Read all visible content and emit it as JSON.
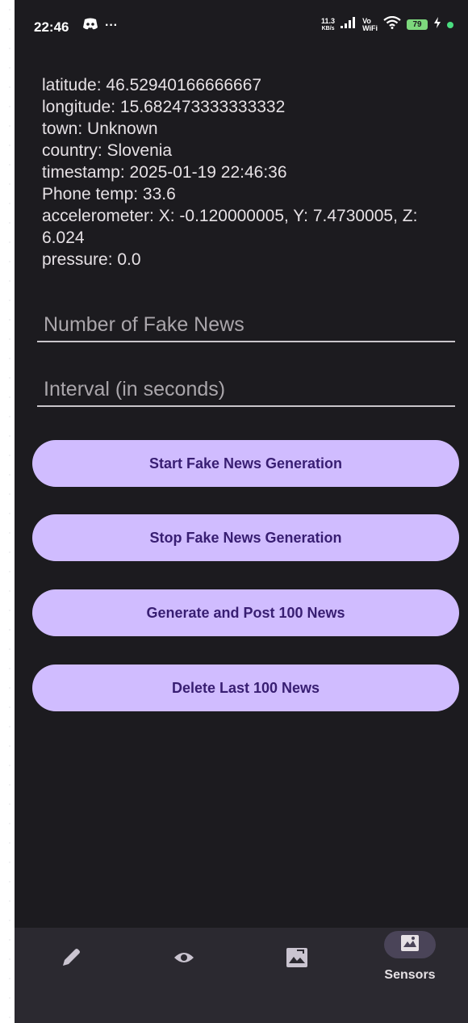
{
  "status_bar": {
    "time": "22:46",
    "left_icons": [
      "discord-icon",
      "more-dots"
    ],
    "more": "···",
    "net_speed_value": "11.3",
    "net_speed_unit": "KB/s",
    "vo": "Vo",
    "wifi_label": "WiFi",
    "battery": "79"
  },
  "info": {
    "latitude": "latitude: 46.52940166666667",
    "longitude": "longitude: 15.682473333333332",
    "town": "town: Unknown",
    "country": "country: Slovenia",
    "timestamp": "timestamp: 2025-01-19 22:46:36",
    "phone_temp": "Phone temp: 33.6",
    "accelerometer": "accelerometer: X: -0.120000005, Y: 7.4730005, Z: 6.024",
    "pressure": "pressure: 0.0"
  },
  "fields": {
    "fake_news_count": {
      "placeholder": "Number of Fake News",
      "value": ""
    },
    "interval": {
      "placeholder": "Interval (in seconds)",
      "value": ""
    }
  },
  "buttons": {
    "start": "Start Fake News Generation",
    "stop": "Stop Fake News Generation",
    "generate": "Generate and Post 100 News",
    "delete": "Delete Last 100 News"
  },
  "nav": {
    "items": [
      {
        "icon": "pencil-icon",
        "label": ""
      },
      {
        "icon": "eye-icon",
        "label": ""
      },
      {
        "icon": "image-icon",
        "label": ""
      },
      {
        "icon": "sensors-icon",
        "label": "Sensors",
        "active": true
      }
    ]
  },
  "colors": {
    "background": "#1c1b1f",
    "button": "#d0bcff",
    "button_text": "#381e72",
    "nav_background": "#2b2930",
    "active_pill": "#4a4458"
  }
}
